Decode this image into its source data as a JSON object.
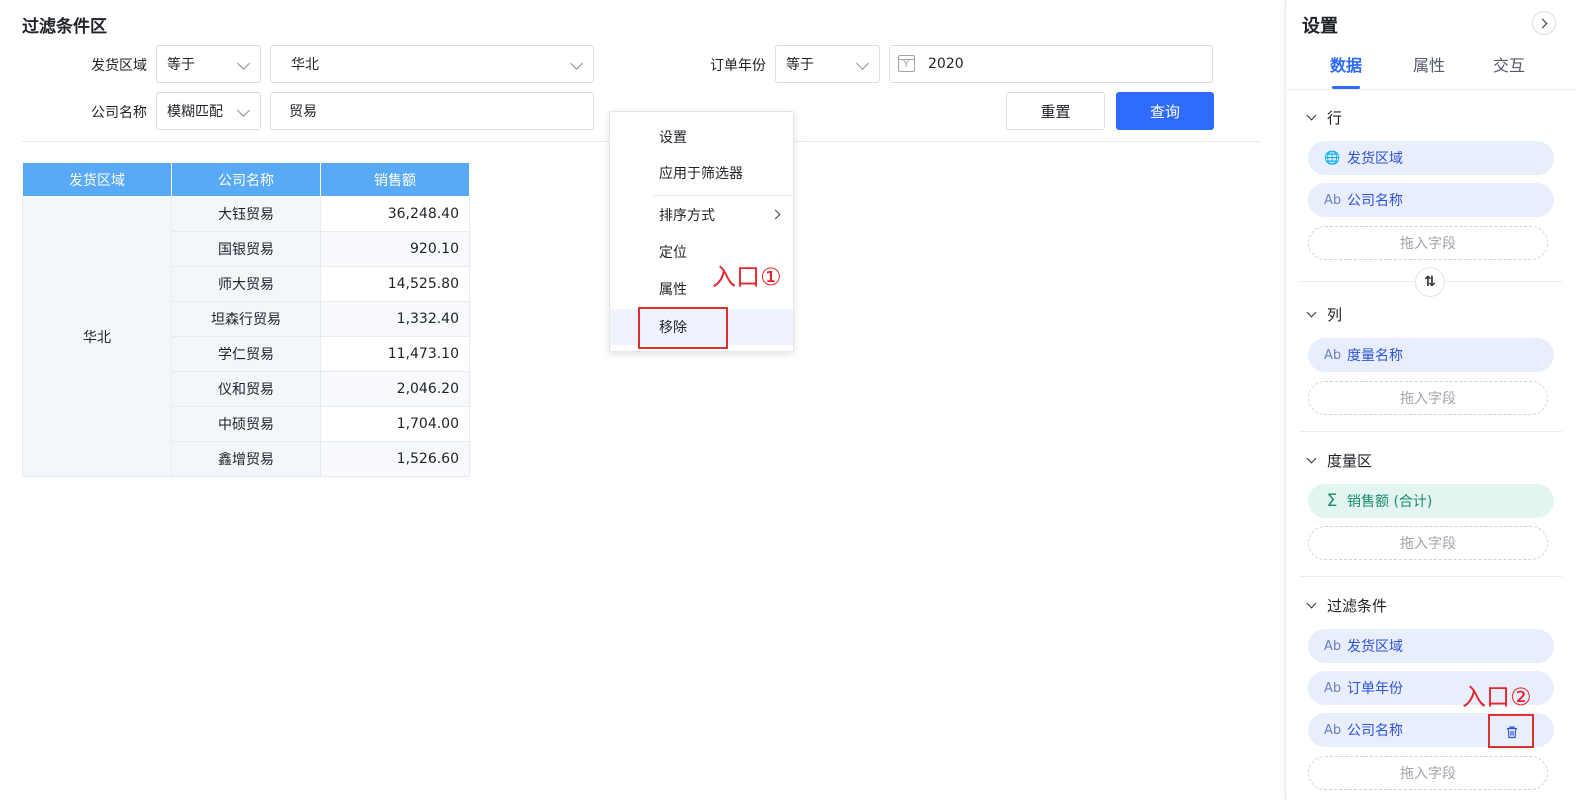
{
  "filter": {
    "title": "过滤条件区",
    "rows": [
      {
        "label": "发货区域",
        "op": "等于",
        "value": "华北"
      },
      {
        "label": "订单年份",
        "op": "等于",
        "value": "2020"
      },
      {
        "label": "公司名称",
        "op": "模糊匹配",
        "value": "贸易"
      }
    ],
    "calendar_glyph": "Y",
    "reset_label": "重置",
    "query_label": "查询"
  },
  "table": {
    "headers": [
      "发货区域",
      "公司名称",
      "销售额"
    ],
    "region": "华北",
    "rows": [
      {
        "company": "大钰贸易",
        "amount": "36,248.40"
      },
      {
        "company": "国银贸易",
        "amount": "920.10"
      },
      {
        "company": "师大贸易",
        "amount": "14,525.80"
      },
      {
        "company": "坦森行贸易",
        "amount": "1,332.40"
      },
      {
        "company": "学仁贸易",
        "amount": "11,473.10"
      },
      {
        "company": "仪和贸易",
        "amount": "2,046.20"
      },
      {
        "company": "中硕贸易",
        "amount": "1,704.00"
      },
      {
        "company": "鑫增贸易",
        "amount": "1,526.60"
      }
    ]
  },
  "context_menu": {
    "items": [
      "设置",
      "应用于筛选器",
      "排序方式",
      "定位",
      "属性",
      "移除"
    ]
  },
  "annotations": {
    "entry1": "入口①",
    "entry2": "入口②"
  },
  "panel": {
    "title": "设置",
    "tabs": [
      "数据",
      "属性",
      "交互"
    ],
    "active_tab": "数据",
    "sections": {
      "row": {
        "title": "行",
        "fields": [
          {
            "icon": "globe-icon",
            "label": "发货区域"
          },
          {
            "icon": "text-type-icon",
            "label": "公司名称"
          }
        ]
      },
      "column": {
        "title": "列",
        "fields": [
          {
            "icon": "text-type-icon",
            "label": "度量名称"
          }
        ]
      },
      "measure": {
        "title": "度量区",
        "fields": [
          {
            "icon": "sigma-icon",
            "label": "销售额 (合计)"
          }
        ]
      },
      "filter": {
        "title": "过滤条件",
        "fields": [
          {
            "icon": "text-type-icon",
            "label": "发货区域"
          },
          {
            "icon": "text-type-icon",
            "label": "订单年份"
          },
          {
            "icon": "text-type-icon",
            "label": "公司名称"
          }
        ]
      }
    },
    "drop_placeholder": "拖入字段",
    "type_glyph": "Ab",
    "sigma_glyph": "Σ",
    "swap_glyph": "⇅"
  },
  "colors": {
    "primary": "#2f6bff",
    "table_header": "#58aaf7",
    "annotation_red": "#e8232a"
  }
}
